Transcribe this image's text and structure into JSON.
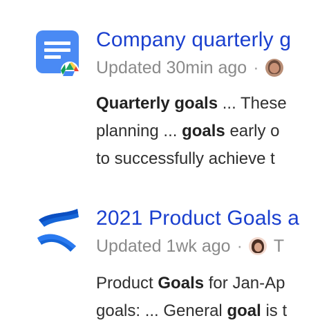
{
  "results": [
    {
      "app_icon": "google-docs-icon",
      "title": "Company quarterly g",
      "meta": {
        "updated": "Updated 30min ago",
        "separator": "·",
        "after_avatar": ""
      },
      "snippet_lines": [
        {
          "parts": [
            {
              "t": "Quarterly goals",
              "b": true
            },
            {
              "t": " ... These",
              "b": false
            }
          ]
        },
        {
          "parts": [
            {
              "t": "planning ... ",
              "b": false
            },
            {
              "t": "goals",
              "b": true
            },
            {
              "t": " early o",
              "b": false
            }
          ]
        },
        {
          "parts": [
            {
              "t": "to successfully achieve t",
              "b": false
            }
          ]
        }
      ]
    },
    {
      "app_icon": "confluence-icon",
      "title": "2021 Product Goals a",
      "meta": {
        "updated": "Updated 1wk ago",
        "separator": "·",
        "after_avatar": "T"
      },
      "snippet_lines": [
        {
          "parts": [
            {
              "t": "Product ",
              "b": false
            },
            {
              "t": "Goals",
              "b": true
            },
            {
              "t": " for Jan-Ap",
              "b": false
            }
          ]
        },
        {
          "parts": [
            {
              "t": "goals: ... General ",
              "b": false
            },
            {
              "t": "goal",
              "b": true
            },
            {
              "t": " is t",
              "b": false
            }
          ]
        }
      ]
    }
  ],
  "colors": {
    "link_title": "#1a3fcf",
    "meta_text": "#8a8a8a",
    "docs_blue": "#4a8af4",
    "confluence_blue": "#1565d8"
  }
}
